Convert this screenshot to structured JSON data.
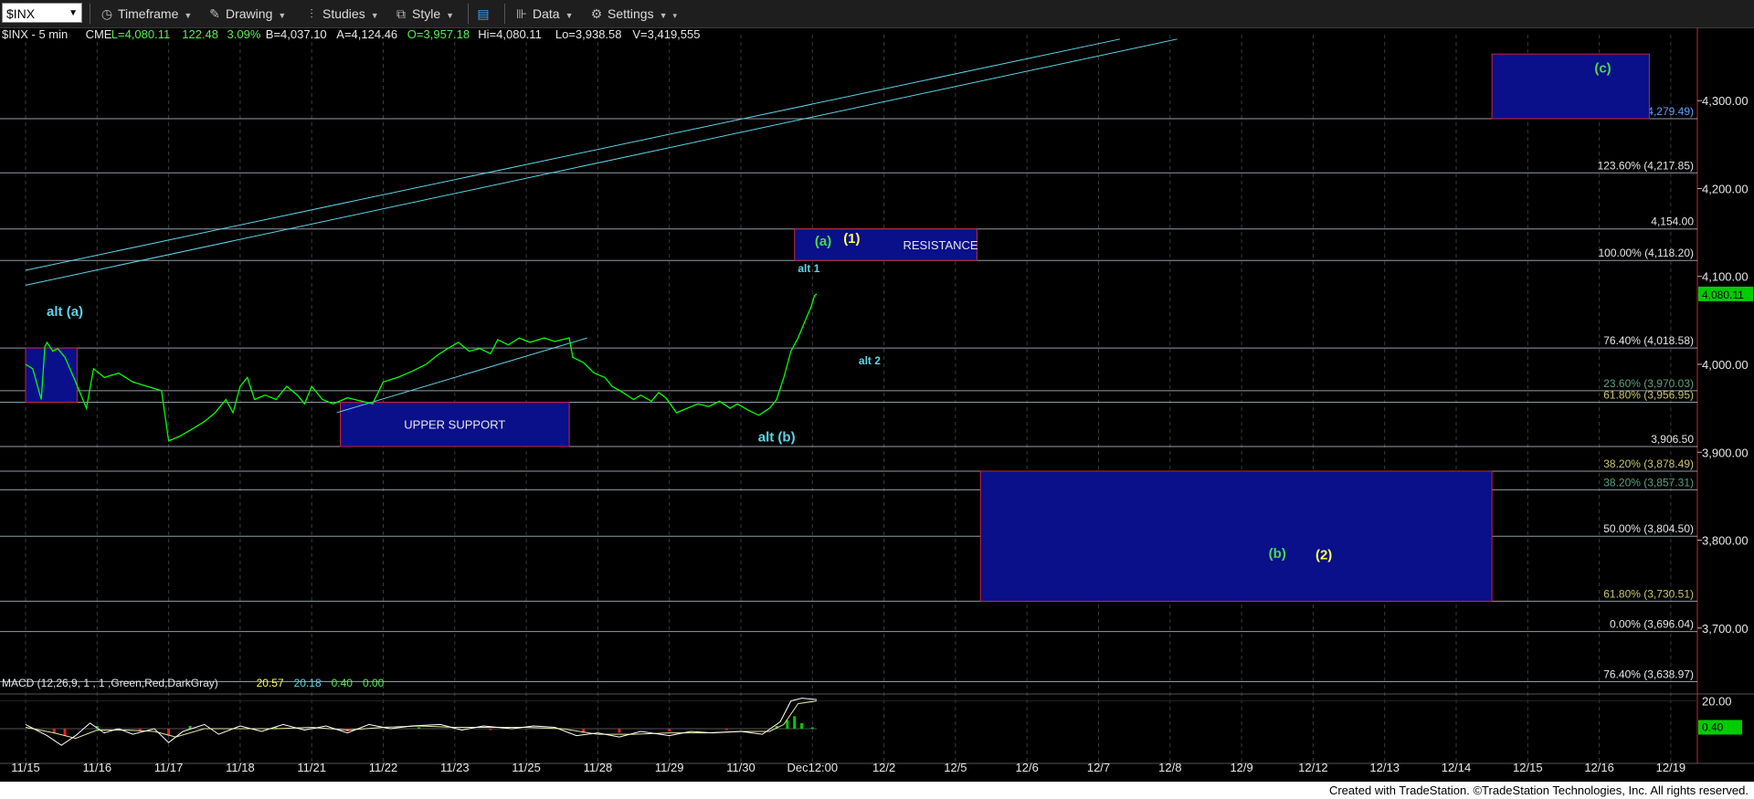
{
  "toolbar": {
    "symbol": "$INX",
    "timeframe_label": "Timeframe",
    "drawing_label": "Drawing",
    "studies_label": "Studies",
    "style_label": "Style",
    "data_label": "Data",
    "settings_label": "Settings"
  },
  "colors": {
    "background": "#000000",
    "price_line": "#00ff00",
    "fib_line": "#9aa8b8",
    "cyan": "#5ed3e6",
    "yellow": "#ffff55",
    "green_label": "#44dd44",
    "box_fill": "#0a0f8a",
    "box_border": "#c8243c",
    "axis_label_bg_price": "#00cc00"
  },
  "chart_data": {
    "type": "line",
    "header": {
      "symbol_text": "$INX - 5 min",
      "exchange": "CME",
      "L": "L=4,080.11",
      "change": "122.48",
      "pct": "3.09%",
      "B": "B=4,037.10",
      "A": "A=4,124.46",
      "O": "O=3,957.18",
      "Hi": "Hi=4,080.11",
      "Lo": "Lo=3,938.58",
      "V": "V=3,419,555"
    },
    "x_axis_labels": [
      "11/15",
      "11/16",
      "11/17",
      "11/18",
      "11/21",
      "11/22",
      "11/23",
      "11/25",
      "11/28",
      "11/29",
      "11/30",
      "Dec12:00",
      "12/2",
      "12/5",
      "12/6",
      "12/7",
      "12/8",
      "12/9",
      "12/12",
      "12/13",
      "12/14",
      "12/15",
      "12/16",
      "12/19"
    ],
    "y_ticks": [
      4300,
      4200,
      4100,
      4000,
      3900,
      3800,
      3700
    ],
    "y_tick_labels": [
      "4,300.00",
      "4,200.00",
      "4,100.00",
      "4,000.00",
      "3,900.00",
      "3,800.00",
      "3,700.00"
    ],
    "ylim": [
      3625,
      4375
    ],
    "last_price_label": "4,080.11",
    "price_path": [
      [
        0,
        4000
      ],
      [
        0.1,
        3995
      ],
      [
        0.22,
        3960
      ],
      [
        0.27,
        4020
      ],
      [
        0.3,
        4025
      ],
      [
        0.38,
        4015
      ],
      [
        0.45,
        4018
      ],
      [
        0.55,
        4008
      ],
      [
        0.7,
        3980
      ],
      [
        0.85,
        3950
      ],
      [
        0.95,
        3995
      ],
      [
        1.1,
        3985
      ],
      [
        1.3,
        3990
      ],
      [
        1.5,
        3980
      ],
      [
        1.7,
        3975
      ],
      [
        1.9,
        3970
      ],
      [
        2.0,
        3913
      ],
      [
        2.15,
        3918
      ],
      [
        2.3,
        3925
      ],
      [
        2.5,
        3935
      ],
      [
        2.65,
        3945
      ],
      [
        2.8,
        3960
      ],
      [
        2.9,
        3945
      ],
      [
        3.0,
        3975
      ],
      [
        3.1,
        3985
      ],
      [
        3.2,
        3960
      ],
      [
        3.35,
        3965
      ],
      [
        3.5,
        3960
      ],
      [
        3.65,
        3975
      ],
      [
        3.8,
        3965
      ],
      [
        3.9,
        3955
      ],
      [
        4.0,
        3975
      ],
      [
        4.15,
        3960
      ],
      [
        4.3,
        3955
      ],
      [
        4.5,
        3962
      ],
      [
        4.7,
        3958
      ],
      [
        4.85,
        3955
      ],
      [
        5.0,
        3980
      ],
      [
        5.2,
        3985
      ],
      [
        5.4,
        3992
      ],
      [
        5.6,
        4000
      ],
      [
        5.75,
        4010
      ],
      [
        5.9,
        4018
      ],
      [
        6.05,
        4025
      ],
      [
        6.2,
        4015
      ],
      [
        6.35,
        4018
      ],
      [
        6.5,
        4012
      ],
      [
        6.6,
        4028
      ],
      [
        6.75,
        4022
      ],
      [
        6.9,
        4030
      ],
      [
        7.05,
        4025
      ],
      [
        7.25,
        4030
      ],
      [
        7.4,
        4026
      ],
      [
        7.5,
        4028
      ],
      [
        7.6,
        4030
      ],
      [
        7.65,
        4008
      ],
      [
        7.8,
        4002
      ],
      [
        7.95,
        3990
      ],
      [
        8.1,
        3985
      ],
      [
        8.2,
        3975
      ],
      [
        8.35,
        3968
      ],
      [
        8.5,
        3960
      ],
      [
        8.6,
        3965
      ],
      [
        8.75,
        3958
      ],
      [
        8.85,
        3968
      ],
      [
        8.95,
        3962
      ],
      [
        9.1,
        3945
      ],
      [
        9.25,
        3950
      ],
      [
        9.4,
        3955
      ],
      [
        9.55,
        3952
      ],
      [
        9.7,
        3958
      ],
      [
        9.85,
        3950
      ],
      [
        9.95,
        3955
      ],
      [
        10.1,
        3948
      ],
      [
        10.25,
        3942
      ],
      [
        10.4,
        3950
      ],
      [
        10.5,
        3960
      ],
      [
        10.6,
        3985
      ],
      [
        10.7,
        4015
      ],
      [
        10.8,
        4030
      ],
      [
        10.9,
        4050
      ],
      [
        10.98,
        4065
      ],
      [
        11.03,
        4078
      ],
      [
        11.06,
        4080.11
      ]
    ],
    "fib_levels": [
      {
        "price": 4279.49,
        "label": "138.20% (4,279.49)",
        "color": "#5ea0ff"
      },
      {
        "price": 4217.85,
        "label": "123.60% (4,217.85)",
        "color": "#e6e6e6"
      },
      {
        "price": 4154.0,
        "label": "4,154.00",
        "color": "#e6e6e6"
      },
      {
        "price": 4118.2,
        "label": "100.00% (4,118.20)",
        "color": "#e6e6e6"
      },
      {
        "price": 4018.58,
        "label": "76.40% (4,018.58)",
        "color": "#e6e6e6"
      },
      {
        "price": 3970.03,
        "label": "23.60% (3,970.03)",
        "color": "#5aa37a"
      },
      {
        "price": 3956.95,
        "label": "61.80% (3,956.95)",
        "color": "#c9c46e"
      },
      {
        "price": 3906.5,
        "label": "3,906.50",
        "color": "#e6e6e6"
      },
      {
        "price": 3878.49,
        "label": "38.20% (3,878.49)",
        "color": "#c9c46e"
      },
      {
        "price": 3857.31,
        "label": "38.20% (3,857.31)",
        "color": "#5aa37a"
      },
      {
        "price": 3804.5,
        "label": "50.00% (3,804.50)",
        "color": "#e6e6e6"
      },
      {
        "price": 3730.51,
        "label": "61.80% (3,730.51)",
        "color": "#c9c46e"
      },
      {
        "price": 3696.04,
        "label": "0.00% (3,696.04)",
        "color": "#e6e6e6"
      },
      {
        "price": 3638.97,
        "label": "76.40% (3,638.97)",
        "color": "#e6e6e6"
      }
    ],
    "boxes": [
      {
        "x0": 0,
        "x1": 0.72,
        "y0": 4018.58,
        "y1": 3956.95,
        "label": ""
      },
      {
        "x0": 4.4,
        "x1": 7.6,
        "y0": 3956.95,
        "y1": 3906.5,
        "label": "UPPER SUPPORT"
      },
      {
        "x0": 10.75,
        "x1": 13.3,
        "y0": 4154,
        "y1": 4118.2,
        "label": "RESISTANCE"
      },
      {
        "x0": 13.35,
        "x1": 20.5,
        "y0": 3878.49,
        "y1": 3730.51,
        "label": ""
      },
      {
        "x0": 20.5,
        "x1": 22.7,
        "y0": 4353,
        "y1": 4279.49,
        "label": ""
      }
    ],
    "trendlines": [
      {
        "x0": 0,
        "y0": 4107,
        "x1": 15.3,
        "y1": 4370
      },
      {
        "x0": 0,
        "y0": 4090,
        "x1": 16.1,
        "y1": 4370
      },
      {
        "x0": 4.35,
        "y0": 3945,
        "x1": 7.85,
        "y1": 4030
      }
    ],
    "annotations": [
      {
        "text": "alt (a)",
        "x": 0.55,
        "y": 4055,
        "color": "#5ed3e6"
      },
      {
        "text": "(a)",
        "x": 11.15,
        "y": 4135,
        "color": "#44dd44"
      },
      {
        "text": "(1)",
        "x": 11.55,
        "y": 4138,
        "color": "#ffff55"
      },
      {
        "text": "alt 1",
        "x": 10.95,
        "y": 4105,
        "color": "#5ed3e6"
      },
      {
        "text": "alt 2",
        "x": 11.8,
        "y": 4000,
        "color": "#5ed3e6"
      },
      {
        "text": "alt (b)",
        "x": 10.5,
        "y": 3912,
        "color": "#5ed3e6"
      },
      {
        "text": "(b)",
        "x": 17.5,
        "y": 3780,
        "color": "#44dd44"
      },
      {
        "text": "(2)",
        "x": 18.15,
        "y": 3778,
        "color": "#ffff55"
      },
      {
        "text": "(c)",
        "x": 22.05,
        "y": 4332,
        "color": "#44dd44"
      }
    ],
    "macd": {
      "label": "MACD (12,26,9, 1 , 1 ,Green,Red,DarkGray)",
      "v1": "20.57",
      "v2": "20.18",
      "v3": "0.40",
      "v4": "0.00",
      "tick_label": "20.00",
      "hist_label": "0.40",
      "ylim": [
        -25,
        25
      ],
      "tick_value": 20,
      "line1": [
        [
          0,
          3
        ],
        [
          0.3,
          -5
        ],
        [
          0.5,
          -12
        ],
        [
          0.7,
          -5
        ],
        [
          0.9,
          4
        ],
        [
          1.1,
          -3
        ],
        [
          1.3,
          0
        ],
        [
          1.5,
          -4
        ],
        [
          1.8,
          0
        ],
        [
          2.0,
          -10
        ],
        [
          2.2,
          -2
        ],
        [
          2.5,
          3
        ],
        [
          2.7,
          -4
        ],
        [
          3.0,
          2
        ],
        [
          3.3,
          -2
        ],
        [
          3.6,
          3
        ],
        [
          3.9,
          -1
        ],
        [
          4.2,
          2
        ],
        [
          4.5,
          -3
        ],
        [
          4.8,
          3
        ],
        [
          5.1,
          0
        ],
        [
          5.4,
          2
        ],
        [
          5.8,
          3
        ],
        [
          6.1,
          -1
        ],
        [
          6.4,
          2
        ],
        [
          6.8,
          0
        ],
        [
          7.1,
          2
        ],
        [
          7.4,
          1
        ],
        [
          7.7,
          -5
        ],
        [
          8.0,
          -3
        ],
        [
          8.3,
          -6
        ],
        [
          8.6,
          -2
        ],
        [
          9.0,
          -5
        ],
        [
          9.3,
          -2
        ],
        [
          9.6,
          -3
        ],
        [
          10.0,
          -2
        ],
        [
          10.3,
          -4
        ],
        [
          10.55,
          5
        ],
        [
          10.7,
          20
        ],
        [
          10.85,
          22
        ],
        [
          11.06,
          21
        ]
      ],
      "line2": [
        [
          0,
          1
        ],
        [
          0.4,
          -3
        ],
        [
          0.7,
          -7
        ],
        [
          1.0,
          -1
        ],
        [
          1.4,
          -1
        ],
        [
          1.8,
          -2
        ],
        [
          2.1,
          -6
        ],
        [
          2.5,
          0
        ],
        [
          3.0,
          0
        ],
        [
          3.5,
          0
        ],
        [
          4.0,
          1
        ],
        [
          4.5,
          -1
        ],
        [
          5.0,
          1
        ],
        [
          5.5,
          2
        ],
        [
          6.0,
          1
        ],
        [
          6.5,
          1
        ],
        [
          7.0,
          1
        ],
        [
          7.5,
          0
        ],
        [
          8.0,
          -4
        ],
        [
          8.5,
          -4
        ],
        [
          9.0,
          -3
        ],
        [
          9.5,
          -3
        ],
        [
          10.0,
          -2
        ],
        [
          10.4,
          -2
        ],
        [
          10.6,
          3
        ],
        [
          10.8,
          18
        ],
        [
          11.06,
          20
        ]
      ],
      "hist": [
        [
          0.4,
          -3
        ],
        [
          0.55,
          -5
        ],
        [
          1.0,
          2
        ],
        [
          1.6,
          -2
        ],
        [
          2.0,
          -5
        ],
        [
          2.3,
          2
        ],
        [
          3.5,
          1
        ],
        [
          4.5,
          -2
        ],
        [
          5.5,
          1
        ],
        [
          6.5,
          -1
        ],
        [
          7.8,
          -3
        ],
        [
          8.3,
          -3
        ],
        [
          9.0,
          -2
        ],
        [
          9.8,
          -1
        ],
        [
          10.5,
          2
        ],
        [
          10.65,
          6
        ],
        [
          10.75,
          9
        ],
        [
          10.85,
          4
        ],
        [
          11.0,
          1
        ]
      ]
    }
  },
  "footer": {
    "credit": "Created with TradeStation. ©TradeStation Technologies, Inc. All rights reserved."
  }
}
